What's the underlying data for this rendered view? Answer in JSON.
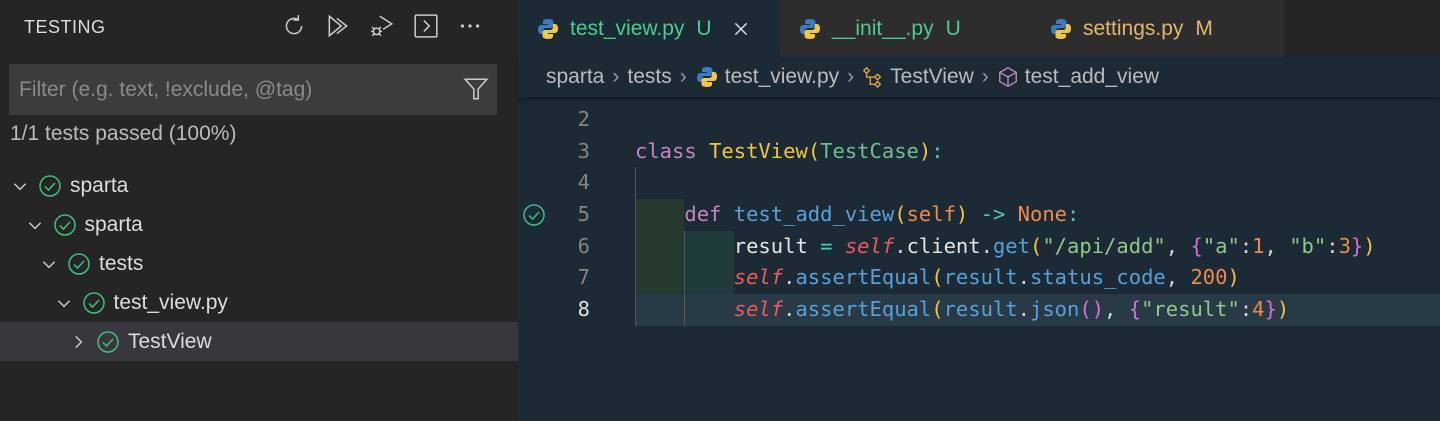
{
  "sidebar": {
    "title": "TESTING",
    "actions": [
      "refresh-icon",
      "run-all-icon",
      "debug-all-icon",
      "terminal-icon",
      "more-icon"
    ],
    "filter_placeholder": "Filter (e.g. text, !exclude, @tag)",
    "summary": "1/1 tests passed (100%)",
    "tree": [
      {
        "label": "sparta",
        "depth": 0,
        "expanded": true
      },
      {
        "label": "sparta",
        "depth": 1,
        "expanded": true
      },
      {
        "label": "tests",
        "depth": 2,
        "expanded": true
      },
      {
        "label": "test_view.py",
        "depth": 3,
        "expanded": true
      },
      {
        "label": "TestView",
        "depth": 4,
        "expanded": false,
        "selected": true
      }
    ]
  },
  "tabs": [
    {
      "label": "test_view.py",
      "badge": "U",
      "color": "#4ec98f",
      "active": true
    },
    {
      "label": "__init__.py",
      "badge": "U",
      "color": "#4ec98f"
    },
    {
      "label": "settings.py",
      "badge": "M",
      "color": "#e2b66e"
    }
  ],
  "breadcrumb": {
    "items": [
      "sparta",
      "tests",
      "test_view.py",
      "TestView",
      "test_add_view"
    ]
  },
  "code": {
    "lines": [
      {
        "n": "2",
        "tokens": []
      },
      {
        "n": "3",
        "tokens": [
          [
            "class ",
            "kw"
          ],
          [
            "TestView",
            "cls"
          ],
          [
            "(",
            "pn"
          ],
          [
            "TestCase",
            "base"
          ],
          [
            ")",
            "pn"
          ],
          [
            ":",
            "op"
          ]
        ]
      },
      {
        "n": "4",
        "tokens": []
      },
      {
        "n": "5",
        "tokens": [
          [
            "    ",
            "pl"
          ],
          [
            "def ",
            "kw"
          ],
          [
            "test_add_view",
            "fn"
          ],
          [
            "(",
            "pn"
          ],
          [
            "self",
            "num"
          ],
          [
            ")",
            "pn"
          ],
          [
            " -> ",
            "op"
          ],
          [
            "None",
            "none"
          ],
          [
            ":",
            "op"
          ]
        ],
        "passed": true
      },
      {
        "n": "6",
        "tokens": [
          [
            "        ",
            "pl"
          ],
          [
            "result",
            "var"
          ],
          [
            " = ",
            "op"
          ],
          [
            "self",
            "self"
          ],
          [
            ".",
            "pl"
          ],
          [
            "client",
            "var"
          ],
          [
            ".",
            "pl"
          ],
          [
            "get",
            "fn"
          ],
          [
            "(",
            "pn"
          ],
          [
            "\"/api/add\"",
            "str"
          ],
          [
            ", ",
            "pl"
          ],
          [
            "{",
            "br2"
          ],
          [
            "\"a\"",
            "str"
          ],
          [
            ":",
            "pl"
          ],
          [
            "1",
            "num"
          ],
          [
            ", ",
            "pl"
          ],
          [
            "\"b\"",
            "str"
          ],
          [
            ":",
            "pl"
          ],
          [
            "3",
            "num"
          ],
          [
            "}",
            "br2"
          ],
          [
            ")",
            "pn"
          ]
        ]
      },
      {
        "n": "7",
        "tokens": [
          [
            "        ",
            "pl"
          ],
          [
            "self",
            "self"
          ],
          [
            ".",
            "pl"
          ],
          [
            "assertEqual",
            "fn"
          ],
          [
            "(",
            "pn"
          ],
          [
            "result",
            "fn"
          ],
          [
            ".",
            "pl"
          ],
          [
            "status_code",
            "fn"
          ],
          [
            ", ",
            "pl"
          ],
          [
            "200",
            "num"
          ],
          [
            ")",
            "pn"
          ]
        ]
      },
      {
        "n": "8",
        "tokens": [
          [
            "        ",
            "pl"
          ],
          [
            "self",
            "self"
          ],
          [
            ".",
            "pl"
          ],
          [
            "assertEqual",
            "fn"
          ],
          [
            "(",
            "pn"
          ],
          [
            "result",
            "fn"
          ],
          [
            ".",
            "pl"
          ],
          [
            "json",
            "fn"
          ],
          [
            "()",
            "br2"
          ],
          [
            ", ",
            "pl"
          ],
          [
            "{",
            "br2"
          ],
          [
            "\"result\"",
            "str"
          ],
          [
            ":",
            "pl"
          ],
          [
            "4",
            "num"
          ],
          [
            "}",
            "br2"
          ],
          [
            ")",
            "pn"
          ]
        ],
        "current": true
      }
    ]
  }
}
